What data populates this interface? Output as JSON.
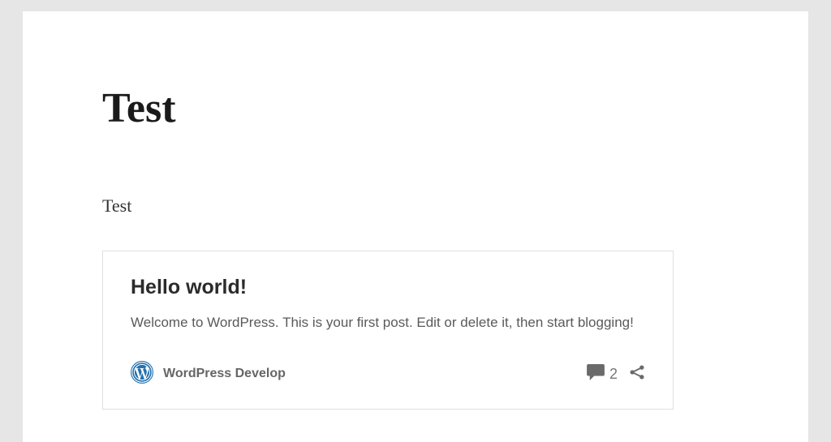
{
  "page": {
    "title": "Test",
    "subtitle": "Test"
  },
  "post": {
    "title": "Hello world!",
    "excerpt": "Welcome to WordPress. This is your first post. Edit or delete it, then start blogging!",
    "source": "WordPress Develop",
    "comment_count": "2"
  }
}
